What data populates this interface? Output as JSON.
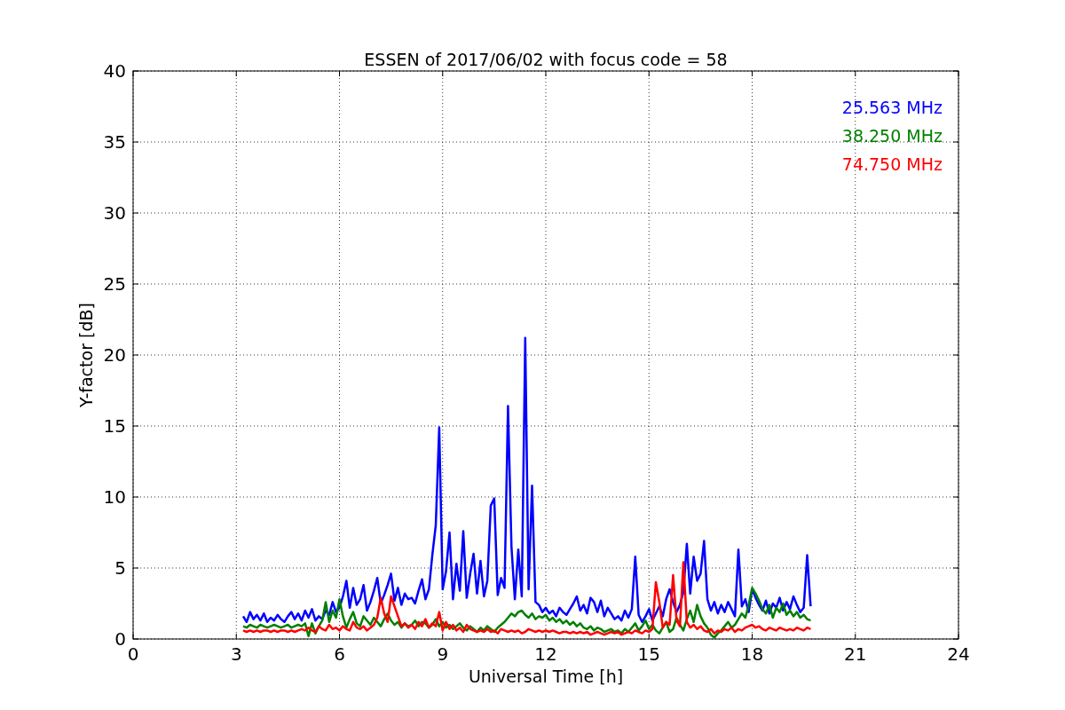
{
  "chart_data": {
    "type": "line",
    "grid": true,
    "title": "ESSEN of 2017/06/02 with focus code = 58",
    "xlabel": "Universal Time [h]",
    "ylabel": "Y-factor [dB]",
    "xlim": [
      0,
      24
    ],
    "ylim": [
      0,
      40
    ],
    "xticks": [
      0,
      3,
      6,
      9,
      12,
      15,
      18,
      21,
      24
    ],
    "yticks": [
      0,
      5,
      10,
      15,
      20,
      25,
      30,
      35,
      40
    ],
    "x": [
      3.2,
      3.3,
      3.4,
      3.5,
      3.6,
      3.7,
      3.8,
      3.9,
      4.0,
      4.1,
      4.2,
      4.3,
      4.4,
      4.5,
      4.6,
      4.7,
      4.8,
      4.9,
      5.0,
      5.1,
      5.2,
      5.3,
      5.4,
      5.5,
      5.6,
      5.7,
      5.8,
      5.9,
      6.0,
      6.1,
      6.2,
      6.3,
      6.4,
      6.5,
      6.6,
      6.7,
      6.8,
      6.9,
      7.0,
      7.1,
      7.2,
      7.3,
      7.4,
      7.5,
      7.6,
      7.7,
      7.8,
      7.9,
      8.0,
      8.1,
      8.2,
      8.3,
      8.4,
      8.5,
      8.6,
      8.7,
      8.8,
      8.9,
      9.0,
      9.1,
      9.2,
      9.3,
      9.4,
      9.5,
      9.6,
      9.7,
      9.8,
      9.9,
      10.0,
      10.1,
      10.2,
      10.3,
      10.4,
      10.5,
      10.6,
      10.7,
      10.8,
      10.9,
      11.0,
      11.1,
      11.2,
      11.3,
      11.4,
      11.5,
      11.6,
      11.7,
      11.8,
      11.9,
      12.0,
      12.1,
      12.2,
      12.3,
      12.4,
      12.5,
      12.6,
      12.7,
      12.8,
      12.9,
      13.0,
      13.1,
      13.2,
      13.3,
      13.4,
      13.5,
      13.6,
      13.7,
      13.8,
      13.9,
      14.0,
      14.1,
      14.2,
      14.3,
      14.4,
      14.5,
      14.6,
      14.7,
      14.8,
      14.9,
      15.0,
      15.1,
      15.2,
      15.3,
      15.4,
      15.5,
      15.6,
      15.7,
      15.8,
      15.9,
      16.0,
      16.1,
      16.2,
      16.3,
      16.4,
      16.5,
      16.6,
      16.7,
      16.8,
      16.9,
      17.0,
      17.1,
      17.2,
      17.3,
      17.4,
      17.5,
      17.6,
      17.7,
      17.8,
      17.9,
      18.0,
      18.1,
      18.2,
      18.3,
      18.4,
      18.5,
      18.6,
      18.7,
      18.8,
      18.9,
      19.0,
      19.1,
      19.2,
      19.3,
      19.4,
      19.5,
      19.6,
      19.7
    ],
    "series": [
      {
        "name": "25.563 MHz",
        "color": "#0000ff",
        "values": [
          1.6,
          1.2,
          1.9,
          1.4,
          1.7,
          1.3,
          1.8,
          1.2,
          1.5,
          1.3,
          1.7,
          1.4,
          1.2,
          1.6,
          1.9,
          1.4,
          1.8,
          1.3,
          2.0,
          1.5,
          2.1,
          1.3,
          1.6,
          1.4,
          2.0,
          1.7,
          2.6,
          1.9,
          2.2,
          3.0,
          4.1,
          2.2,
          3.6,
          2.4,
          2.8,
          3.8,
          2.0,
          2.6,
          3.4,
          4.3,
          2.5,
          3.1,
          3.8,
          4.6,
          2.7,
          3.6,
          2.4,
          3.2,
          2.8,
          2.9,
          2.5,
          3.4,
          4.2,
          2.8,
          3.5,
          5.9,
          8.0,
          14.9,
          3.5,
          4.8,
          7.5,
          2.8,
          5.3,
          3.4,
          7.6,
          2.9,
          4.6,
          6.0,
          3.2,
          5.5,
          3.0,
          4.1,
          9.4,
          9.9,
          3.1,
          4.3,
          3.6,
          16.4,
          6.5,
          2.8,
          6.3,
          3.0,
          21.2,
          3.5,
          10.8,
          2.6,
          2.4,
          1.9,
          2.2,
          1.8,
          2.0,
          1.6,
          2.2,
          1.9,
          1.7,
          2.1,
          2.5,
          3.0,
          2.0,
          2.4,
          1.8,
          2.9,
          2.6,
          1.9,
          2.7,
          1.6,
          2.2,
          1.8,
          1.4,
          1.6,
          1.3,
          2.0,
          1.5,
          2.1,
          5.8,
          1.7,
          1.2,
          1.6,
          2.1,
          1.3,
          1.8,
          2.3,
          1.6,
          2.8,
          3.5,
          2.6,
          1.9,
          2.4,
          3.3,
          6.7,
          3.2,
          5.8,
          4.1,
          4.6,
          6.9,
          2.8,
          2.0,
          2.6,
          1.8,
          2.4,
          1.9,
          2.6,
          2.1,
          1.6,
          6.3,
          2.3,
          2.8,
          1.9,
          3.5,
          2.9,
          2.4,
          2.0,
          2.7,
          1.8,
          2.5,
          2.2,
          2.9,
          2.0,
          2.6,
          2.1,
          3.0,
          2.4,
          1.9,
          2.2,
          5.9,
          2.3
        ]
      },
      {
        "name": "38.250 MHz",
        "color": "#008000",
        "values": [
          0.9,
          0.8,
          1.0,
          0.9,
          0.8,
          1.0,
          0.9,
          0.8,
          0.9,
          1.0,
          0.9,
          0.8,
          0.9,
          1.0,
          0.8,
          0.9,
          1.0,
          0.9,
          1.1,
          0.2,
          1.1,
          0.4,
          0.9,
          1.3,
          2.6,
          1.2,
          2.0,
          1.5,
          2.8,
          1.6,
          0.8,
          1.4,
          1.9,
          1.1,
          0.9,
          1.6,
          1.3,
          1.0,
          1.5,
          1.2,
          0.9,
          1.4,
          1.8,
          1.3,
          1.0,
          1.2,
          0.8,
          1.1,
          0.9,
          1.0,
          1.3,
          0.9,
          1.2,
          1.1,
          0.8,
          1.0,
          1.4,
          0.9,
          1.2,
          0.8,
          1.0,
          0.7,
          0.9,
          1.1,
          0.8,
          0.6,
          0.9,
          0.7,
          0.5,
          0.8,
          0.6,
          0.9,
          0.7,
          0.5,
          0.8,
          1.0,
          1.2,
          1.5,
          1.8,
          1.6,
          1.9,
          2.0,
          1.7,
          1.5,
          1.8,
          1.4,
          1.6,
          1.5,
          1.7,
          1.3,
          1.5,
          1.2,
          1.4,
          1.1,
          1.3,
          1.0,
          1.2,
          0.9,
          1.1,
          0.8,
          0.7,
          0.9,
          0.6,
          0.8,
          0.7,
          0.5,
          0.6,
          0.7,
          0.5,
          0.6,
          0.4,
          0.7,
          0.5,
          0.8,
          1.1,
          0.6,
          0.9,
          1.3,
          0.7,
          1.0,
          0.6,
          0.4,
          0.8,
          1.2,
          0.5,
          0.7,
          1.5,
          1.0,
          0.6,
          1.4,
          2.0,
          1.2,
          2.4,
          1.6,
          1.1,
          0.8,
          0.3,
          0.1,
          0.4,
          0.6,
          0.9,
          1.2,
          0.8,
          1.0,
          1.4,
          1.8,
          1.5,
          2.4,
          3.6,
          3.2,
          2.7,
          2.1,
          1.8,
          2.4,
          1.5,
          2.2,
          1.9,
          2.5,
          1.7,
          2.0,
          1.6,
          1.9,
          1.5,
          1.7,
          1.4,
          1.3
        ]
      },
      {
        "name": "74.750 MHz",
        "color": "#ff0000",
        "values": [
          0.6,
          0.5,
          0.6,
          0.5,
          0.6,
          0.5,
          0.6,
          0.6,
          0.5,
          0.6,
          0.5,
          0.6,
          0.6,
          0.5,
          0.6,
          0.5,
          0.6,
          0.7,
          0.6,
          0.8,
          0.6,
          0.5,
          0.9,
          0.7,
          0.6,
          1.0,
          0.7,
          0.8,
          0.6,
          0.9,
          0.7,
          0.6,
          1.2,
          0.8,
          0.7,
          0.9,
          0.6,
          0.8,
          1.0,
          1.5,
          2.9,
          1.8,
          1.2,
          3.0,
          2.3,
          1.6,
          0.9,
          1.1,
          0.8,
          1.0,
          0.7,
          1.2,
          0.9,
          1.4,
          0.8,
          1.1,
          0.9,
          1.9,
          0.6,
          1.2,
          0.7,
          1.0,
          0.6,
          0.8,
          0.5,
          1.0,
          0.7,
          0.6,
          0.5,
          0.6,
          0.5,
          0.7,
          0.5,
          0.6,
          0.4,
          0.7,
          0.6,
          0.5,
          0.6,
          0.5,
          0.6,
          0.4,
          0.5,
          0.7,
          0.6,
          0.5,
          0.6,
          0.5,
          0.6,
          0.5,
          0.6,
          0.5,
          0.4,
          0.5,
          0.5,
          0.4,
          0.5,
          0.4,
          0.5,
          0.4,
          0.5,
          0.3,
          0.4,
          0.5,
          0.4,
          0.3,
          0.4,
          0.5,
          0.4,
          0.5,
          0.3,
          0.4,
          0.5,
          0.4,
          0.6,
          0.5,
          0.4,
          0.6,
          0.5,
          0.7,
          4.0,
          2.6,
          0.8,
          1.2,
          1.0,
          4.5,
          1.3,
          0.9,
          5.4,
          1.2,
          0.8,
          1.0,
          0.7,
          0.9,
          0.6,
          0.5,
          0.7,
          0.4,
          0.6,
          0.5,
          0.7,
          0.6,
          0.8,
          0.5,
          0.7,
          0.6,
          0.8,
          0.9,
          1.0,
          0.8,
          0.9,
          0.7,
          0.6,
          0.8,
          0.7,
          0.6,
          0.8,
          0.7,
          0.6,
          0.7,
          0.6,
          0.8,
          0.7,
          0.6,
          0.8,
          0.7
        ]
      }
    ]
  }
}
